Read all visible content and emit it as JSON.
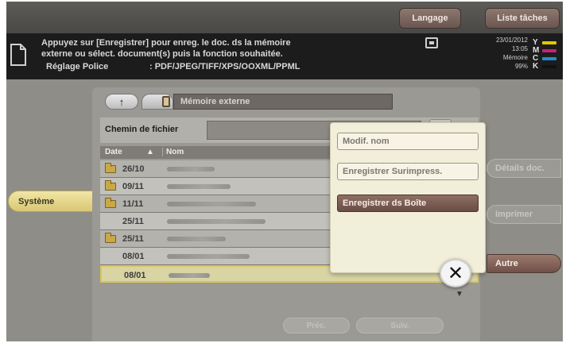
{
  "top_bar": {
    "langage_label": "Langage",
    "liste_taches_label": "Liste tâches"
  },
  "message": {
    "line1": "Appuyez sur [Enregistrer] pour enreg. le doc. ds la mémoire",
    "line2": "externe ou sélect. document(s) puis la fonction souhaitée.",
    "reglage_label": "Réglage Police",
    "reglage_value": ": PDF/JPEG/TIFF/XPS/OOXML/PPML"
  },
  "status": {
    "date": "23/01/2012",
    "time": "13:05",
    "memory_label": "Mémoire",
    "memory_percent": "99%",
    "toners": [
      {
        "letter": "Y",
        "color": "#e3c800"
      },
      {
        "letter": "M",
        "color": "#c8207a"
      },
      {
        "letter": "C",
        "color": "#1f8fd0"
      },
      {
        "letter": "K",
        "color": "#111111"
      }
    ]
  },
  "left_tab": {
    "systeme_label": "Système"
  },
  "panel": {
    "nav_up_label": "↑",
    "path": "Mémoire externe",
    "file_path_label": "Chemin de fichier",
    "columns": {
      "date": "Date",
      "sort": "▲",
      "nom": "Nom"
    },
    "files": [
      {
        "date": "26/10",
        "folder": true,
        "selected": false
      },
      {
        "date": "09/11",
        "folder": true,
        "selected": false
      },
      {
        "date": "11/11",
        "folder": true,
        "selected": false
      },
      {
        "date": "25/11",
        "folder": false,
        "selected": false
      },
      {
        "date": "25/11",
        "folder": true,
        "selected": false
      },
      {
        "date": "08/01",
        "folder": false,
        "selected": false
      },
      {
        "date": "08/01",
        "folder": false,
        "selected": true
      }
    ],
    "prev_label": "Préc.",
    "next_label": "Suiv."
  },
  "popup": {
    "modif_nom": "Modif. nom",
    "enregistrer_surimpress": "Enregistrer Surimpress.",
    "enregistrer_boite": "Enregistrer ds Boîte",
    "close_label": "✕",
    "scroll_label": "▼"
  },
  "side": {
    "details_doc": "Détails doc.",
    "imprimer": "Imprimer",
    "autre": "Autre"
  }
}
